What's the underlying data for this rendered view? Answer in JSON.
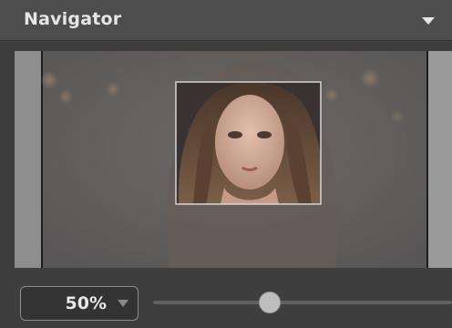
{
  "panel": {
    "title": "Navigator",
    "collapse_icon": "triangle-down-icon"
  },
  "preview": {
    "image_subject": "portrait-photo",
    "frame_icon": "viewport-frame"
  },
  "zoom": {
    "value": "50%",
    "dropdown_icon": "chevron-down-icon",
    "slider_level": 0.4
  },
  "colors": {
    "panel_bg": "#3e3e3e",
    "header_bg": "#4d4d4d",
    "text": "#e6e6e6",
    "slider_thumb": "#bdbdbd"
  }
}
